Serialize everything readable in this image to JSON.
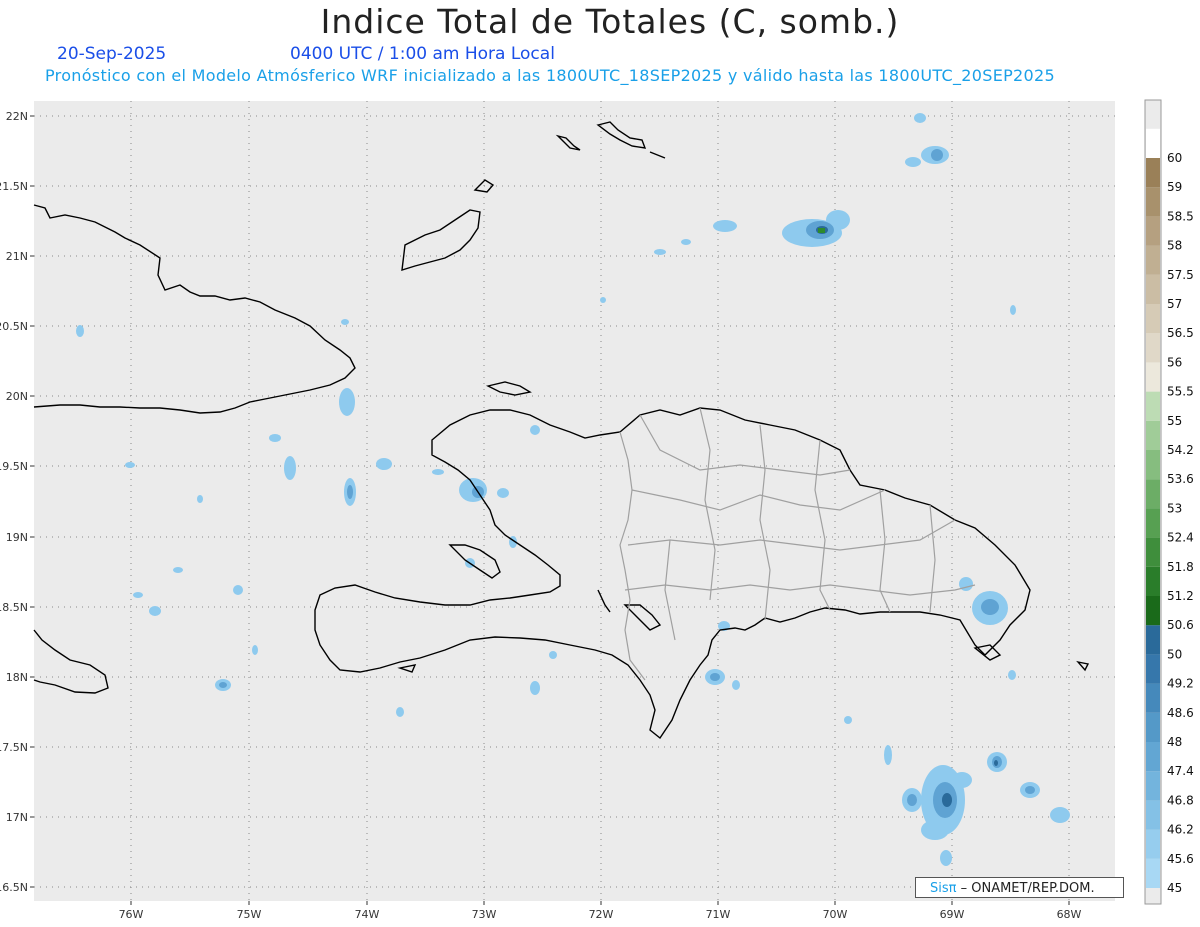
{
  "header": {
    "title": "Indice Total de Totales (C, somb.)",
    "date": "20-Sep-2025",
    "time": "0400 UTC / 1:00 am Hora Local",
    "subtitle": "Pronóstico con el Modelo Atmósferico WRF inicializado a las 1800UTC_18SEP2025 y válido hasta las  1800UTC_20SEP2025"
  },
  "map": {
    "lat_labels": [
      "22N",
      "21.5N",
      "21N",
      "20.5N",
      "20N",
      "19.5N",
      "19N",
      "18.5N",
      "18N",
      "17.5N",
      "17N",
      "16.5N"
    ],
    "lon_labels": [
      "76W",
      "75W",
      "74W",
      "73W",
      "72W",
      "71W",
      "70W",
      "69W",
      "68W"
    ],
    "background_color": "#ebebeb",
    "coast_color": "#000000",
    "border_color": "#a0a0a0"
  },
  "colorbar": {
    "labels": [
      "45",
      "45.6",
      "46.2",
      "46.8",
      "47.4",
      "48",
      "48.6",
      "49.2",
      "50",
      "50.6",
      "51.2",
      "51.8",
      "52.4",
      "53",
      "53.6",
      "54.2",
      "55",
      "55.5",
      "56",
      "56.5",
      "57",
      "57.5",
      "58",
      "58.5",
      "59",
      "60"
    ],
    "colors": [
      "#a8d8f4",
      "#96cdee",
      "#84c1e6",
      "#73b4dd",
      "#62a6d3",
      "#5499c8",
      "#4589bb",
      "#3677ab",
      "#2a6a9a",
      "#1a6a1a",
      "#2a7d2a",
      "#3f8e3c",
      "#57a052",
      "#6cad66",
      "#86bd7f",
      "#a0cc98",
      "#bddcb4",
      "#ece8dc",
      "#e0d8c8",
      "#d6cbb6",
      "#cbbda4",
      "#c0af92",
      "#b5a080",
      "#a8916c",
      "#9a8058",
      "#ffffff"
    ]
  },
  "credit": {
    "brand": "Sisπ",
    "text": "– ONAMET/REP.DOM."
  }
}
